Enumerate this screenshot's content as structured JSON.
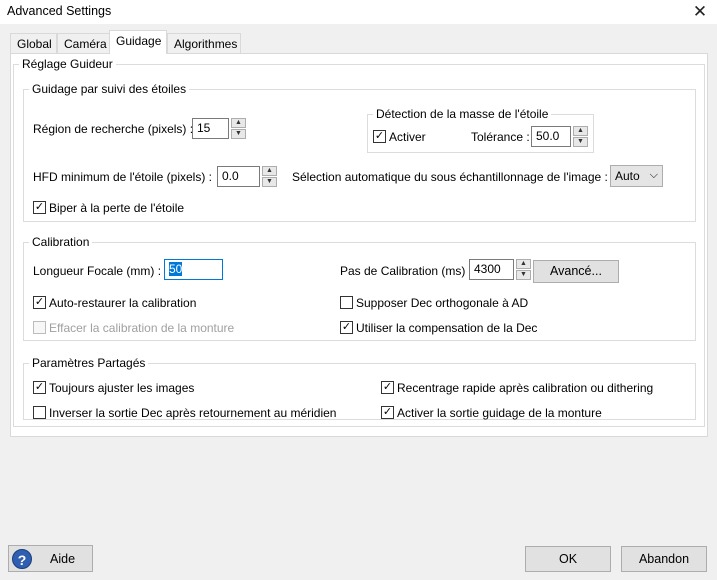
{
  "window": {
    "title": "Advanced Settings",
    "close_glyph": "✕"
  },
  "tabs": [
    {
      "label": "Global"
    },
    {
      "label": "Caméra"
    },
    {
      "label": "Guidage",
      "active": true
    },
    {
      "label": "Algorithmes"
    }
  ],
  "guider": {
    "group_title": "Réglage Guideur",
    "star_tracking": {
      "title": "Guidage par suivi des étoiles",
      "search_region_label": "Région de recherche (pixels) :",
      "search_region_value": "15",
      "mass_detection": {
        "title": "Détection de la masse de l'étoile",
        "enable_label": "Activer",
        "enable_checked": true,
        "tolerance_label": "Tolérance :",
        "tolerance_value": "50.0"
      },
      "min_hfd_label": "HFD minimum de l'étoile (pixels) :",
      "min_hfd_value": "0.0",
      "auto_binning_label": "Sélection automatique du sous échantillonnage de l'image :",
      "auto_binning_value": "Auto",
      "beep_label": "Biper à la perte de l'étoile",
      "beep_checked": true
    },
    "calibration": {
      "title": "Calibration",
      "focal_length_label": "Longueur Focale (mm) :",
      "focal_length_value": "50",
      "cal_step_label": "Pas de Calibration (ms) :",
      "cal_step_value": "4300",
      "advanced_button": "Avancé...",
      "auto_restore_label": "Auto-restaurer la calibration",
      "auto_restore_checked": true,
      "assume_dec_orth_label": "Supposer Dec orthogonale à AD",
      "assume_dec_orth_checked": false,
      "clear_mount_cal_label": "Effacer la calibration de la monture",
      "clear_mount_cal_checked": false,
      "use_dec_comp_label": "Utiliser la compensation de la Dec",
      "use_dec_comp_checked": true
    },
    "shared": {
      "title": "Paramètres Partagés",
      "always_scale_label": "Toujours ajuster les images",
      "always_scale_checked": true,
      "fast_recenter_label": "Recentrage rapide après calibration ou dithering",
      "fast_recenter_checked": true,
      "reverse_dec_label": "Inverser la sortie Dec après retournement au méridien",
      "reverse_dec_checked": false,
      "enable_mount_guide_label": "Activer la sortie guidage de la monture",
      "enable_mount_guide_checked": true
    }
  },
  "footer": {
    "help_icon": "?",
    "help_label": "Aide",
    "ok_label": "OK",
    "cancel_label": "Abandon"
  },
  "glyphs": {
    "check": "✓",
    "up": "▲",
    "down": "▼",
    "chevron": "⌵"
  }
}
